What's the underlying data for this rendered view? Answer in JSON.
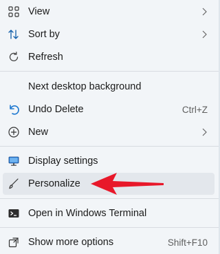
{
  "menu": {
    "items": {
      "view": {
        "label": "View",
        "icon": "grid-icon"
      },
      "sort_by": {
        "label": "Sort by",
        "icon": "sort-arrows-icon"
      },
      "refresh": {
        "label": "Refresh",
        "icon": "refresh-icon"
      },
      "next_bg": {
        "label": "Next desktop background"
      },
      "undo_delete": {
        "label": "Undo Delete",
        "icon": "undo-icon",
        "shortcut": "Ctrl+Z"
      },
      "new": {
        "label": "New",
        "icon": "plus-circle-icon"
      },
      "display_settings": {
        "label": "Display settings",
        "icon": "monitor-icon"
      },
      "personalize": {
        "label": "Personalize",
        "icon": "brush-icon"
      },
      "terminal": {
        "label": "Open in Windows Terminal",
        "icon": "terminal-icon"
      },
      "more_options": {
        "label": "Show more options",
        "icon": "expand-icon",
        "shortcut": "Shift+F10"
      }
    }
  },
  "colors": {
    "accent": "#0067c0",
    "annotation_arrow": "#e8182a"
  }
}
